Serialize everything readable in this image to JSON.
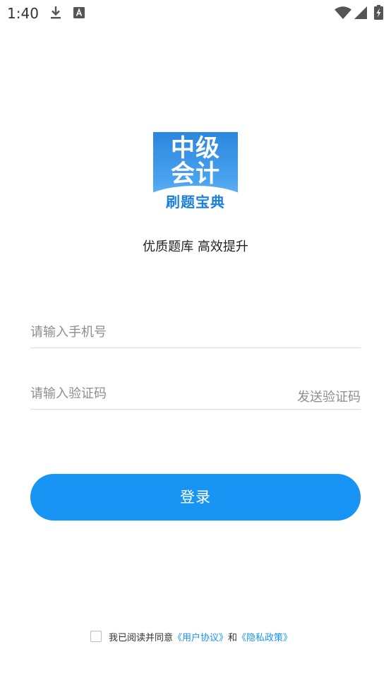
{
  "status_bar": {
    "time": "1:40",
    "left_icons": [
      "download-icon",
      "keyboard-a-icon"
    ],
    "right_icons": [
      "wifi-icon",
      "signal-icon",
      "battery-charging-icon"
    ]
  },
  "logo": {
    "line1": "中级",
    "line2": "会计",
    "line3": "刷题宝典"
  },
  "slogan": "优质题库 高效提升",
  "phone_field": {
    "placeholder": "请输入手机号",
    "value": ""
  },
  "code_field": {
    "placeholder": "请输入验证码",
    "value": "",
    "send_label": "发送验证码"
  },
  "login_button": "登录",
  "agreement": {
    "prefix": "我已阅读并同意",
    "user_agreement": "《用户协议》",
    "and": "和",
    "privacy_policy": "《隐私政策》",
    "checked": false
  },
  "colors": {
    "primary": "#1894f5",
    "placeholder": "#8e8e8e",
    "divider": "#dcdcdc"
  }
}
